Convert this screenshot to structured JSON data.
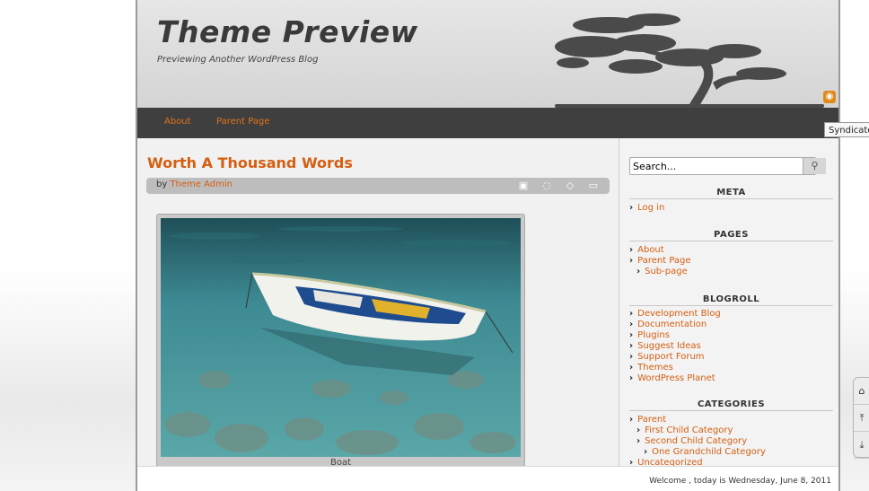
{
  "site": {
    "title": "Theme Preview",
    "tagline": "Previewing Another WordPress Blog"
  },
  "nav": [
    "About",
    "Parent Page"
  ],
  "post": {
    "title": "Worth A Thousand Words",
    "by_prefix": "by",
    "author": "Theme Admin",
    "icons": [
      "calendar-icon",
      "comment-icon",
      "tag-icon",
      "folder-icon"
    ],
    "image_caption": "Boat"
  },
  "sidebar": {
    "search_value": "Search...",
    "meta": {
      "title": "META",
      "items": [
        "Log in"
      ]
    },
    "pages": {
      "title": "PAGES",
      "items": [
        "About",
        "Parent Page",
        "Sub-page"
      ]
    },
    "blogroll": {
      "title": "BLOGROLL",
      "items": [
        "Development Blog",
        "Documentation",
        "Plugins",
        "Suggest Ideas",
        "Support Forum",
        "Themes",
        "WordPress Planet"
      ]
    },
    "categories": {
      "title": "CATEGORIES",
      "items": [
        "Parent",
        "First Child Category",
        "Second Child Category",
        "One Grandchild Category",
        "Uncategorized"
      ]
    }
  },
  "footer": {
    "text": "Welcome , today is Wednesday, June 8, 2011"
  },
  "tooltip": "Syndicate",
  "colors": {
    "accent": "#d45f12",
    "navbar": "#3f3f3f",
    "rss": "#e08a1e"
  }
}
